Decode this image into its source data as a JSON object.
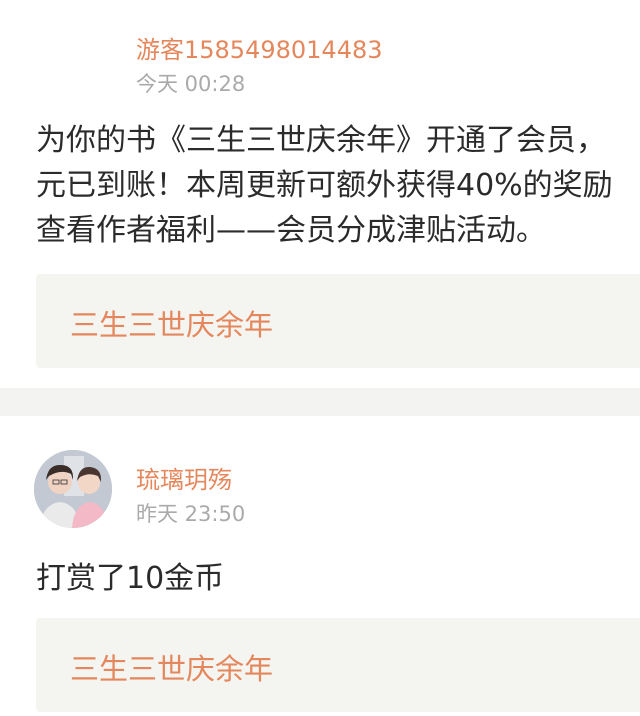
{
  "feed": {
    "posts": [
      {
        "user": "游客1585498014483",
        "time": "今天 00:28",
        "lines": [
          "为你的书《三生三世庆余年》开通了会员，",
          "元已到账！本周更新可额外获得40%的奖励",
          "查看作者福利——会员分成津贴活动。"
        ],
        "book": "三生三世庆余年"
      },
      {
        "user": "琉璃玥殇",
        "time": "昨天 23:50",
        "lines": [
          "打赏了10金币"
        ],
        "book": "三生三世庆余年"
      }
    ]
  },
  "colors": {
    "accent": "#e5875c",
    "meta": "#aaaaaa",
    "text": "#2b2b2b",
    "card_bg": "#f4f4f1",
    "divider": "#f3f3f1"
  }
}
